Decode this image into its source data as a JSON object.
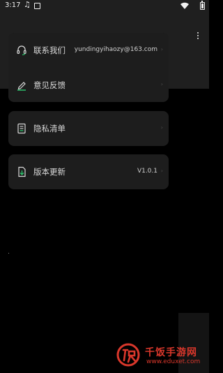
{
  "status_bar": {
    "time": "3:17",
    "icons": [
      "music-note-icon",
      "gallery-icon",
      "wifi-icon",
      "battery-icon"
    ]
  },
  "menu": {
    "contact": {
      "label": "联系我们",
      "value": "yundingyihaozy@163.com",
      "icon": "headset-icon"
    },
    "feedback": {
      "label": "意见反馈",
      "value": "",
      "icon": "pencil-icon"
    },
    "privacy": {
      "label": "隐私清单",
      "value": "",
      "icon": "list-document-icon"
    },
    "version": {
      "label": "版本更新",
      "value": "V1.0.1",
      "icon": "download-document-icon"
    }
  },
  "watermark": {
    "brand": "千饭手游网",
    "url": "www.eduxet.com"
  },
  "colors": {
    "background": "#000000",
    "card": "#1d1d1d",
    "header": "#1f1f1f",
    "icon_accent": "#2ecc71",
    "watermark": "#d9372b"
  }
}
